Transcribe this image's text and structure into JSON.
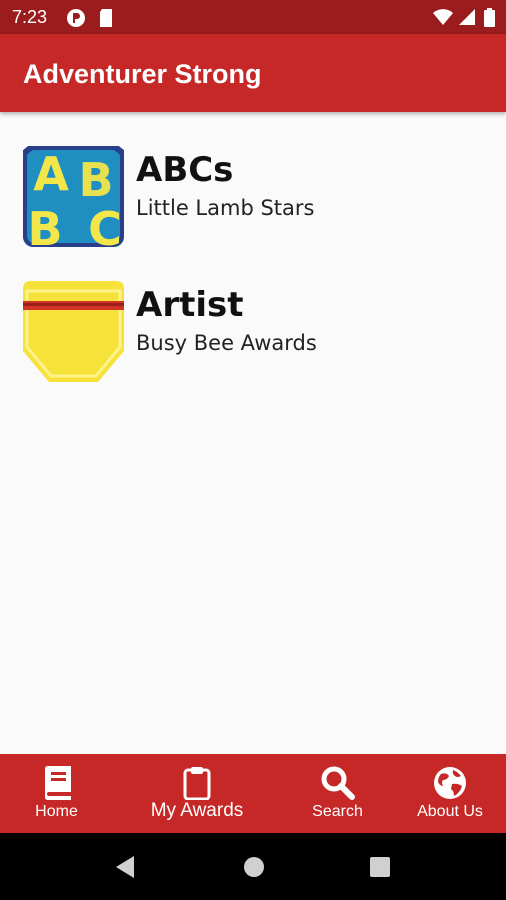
{
  "status": {
    "time": "7:23"
  },
  "app": {
    "title": "Adventurer Strong"
  },
  "items": [
    {
      "title": "ABCs",
      "subtitle": "Little Lamb Stars",
      "icon": "abc-patch-image"
    },
    {
      "title": "Artist",
      "subtitle": "Busy Bee Awards",
      "icon": "artist-pencil-patch-image"
    }
  ],
  "nav": [
    {
      "label": "Home",
      "icon": "book-icon"
    },
    {
      "label": "My Awards",
      "icon": "clipboard-icon",
      "active": true
    },
    {
      "label": "Search",
      "icon": "search-icon"
    },
    {
      "label": "About Us",
      "icon": "globe-icon"
    }
  ],
  "colors": {
    "primary": "#c62828",
    "status_bar": "#9a1c1c",
    "background": "#fafafa"
  }
}
